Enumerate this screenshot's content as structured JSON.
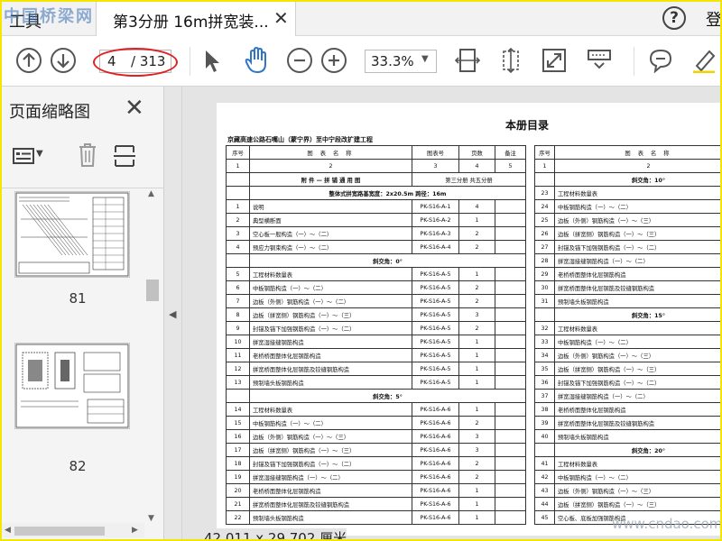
{
  "tabbar": {
    "tools_label": "工具",
    "site_logo": "中国桥梁网",
    "doc_tab_title": "第3分册 16m拼宽装...",
    "close_glyph": "✕",
    "help_glyph": "?",
    "sign_in": "登"
  },
  "toolbar": {
    "prev_page_icon": "arrow-up-circle",
    "next_page_icon": "arrow-down-circle",
    "current_page": "4",
    "total_pages": "/ 313",
    "zoom": "33.3%",
    "highlight_color": "#e02020"
  },
  "sidebar": {
    "title": "页面缩略图",
    "thumbnails": [
      {
        "page": "81"
      },
      {
        "page": "82"
      }
    ]
  },
  "document": {
    "book_title": "本册目录",
    "project_title": "京藏高速公路石嘴山（蒙宁界）至中宁段改扩建工程",
    "left_header": {
      "no": "序号",
      "name": "图 表 名 称",
      "code": "图表号",
      "pages": "页数",
      "note": "备注"
    },
    "left_index": [
      "1",
      "2",
      "3",
      "4",
      "5"
    ],
    "left_rows": [
      {
        "type": "sec",
        "name": "附 件 — 拼 铺 通 用 图",
        "code": "第三分册 共五分册"
      },
      {
        "type": "sec",
        "name": "整体式拼宽路基宽度：2x20.5m 跨径：16m"
      },
      {
        "no": "1",
        "name": "说明",
        "code": "PK-S16-A-1",
        "pages": "4"
      },
      {
        "no": "2",
        "name": "典型横断面",
        "code": "PK-S16-A-2",
        "pages": "1"
      },
      {
        "no": "3",
        "name": "空心板一般构造（一）～（二）",
        "code": "PK-S16-A-3",
        "pages": "2"
      },
      {
        "no": "4",
        "name": "预应力钢束构造（一）～（二）",
        "code": "PK-S16-A-4",
        "pages": "2"
      },
      {
        "type": "sec",
        "name": "斜交角：0°"
      },
      {
        "no": "5",
        "name": "工程材料数量表",
        "code": "PK-S16-A-5",
        "pages": "1"
      },
      {
        "no": "6",
        "name": "中板钢筋构造（一）～（二）",
        "code": "PK-S16-A-5",
        "pages": "2"
      },
      {
        "no": "7",
        "name": "边板（外侧）钢筋构造（一）～（二）",
        "code": "PK-S16-A-5",
        "pages": "2"
      },
      {
        "no": "8",
        "name": "边板（拼宽侧）钢筋构造（一）～（三）",
        "code": "PK-S16-A-5",
        "pages": "3"
      },
      {
        "no": "9",
        "name": "封锚及锚下加强钢筋构造（一）～（二）",
        "code": "PK-S16-A-5",
        "pages": "2"
      },
      {
        "no": "10",
        "name": "拼宽湿接缝钢筋构造",
        "code": "PK-S16-A-5",
        "pages": "1"
      },
      {
        "no": "11",
        "name": "老桥桥面整体化层钢筋构造",
        "code": "PK-S16-A-5",
        "pages": "1"
      },
      {
        "no": "12",
        "name": "拼宽桥面整体化层钢筋及铰缝钢筋构造",
        "code": "PK-S16-A-5",
        "pages": "1"
      },
      {
        "no": "13",
        "name": "预制墙头板钢筋构造",
        "code": "PK-S16-A-5",
        "pages": "1"
      },
      {
        "type": "sec",
        "name": "斜交角：5°"
      },
      {
        "no": "14",
        "name": "工程材料数量表",
        "code": "PK-S16-A-6",
        "pages": "1"
      },
      {
        "no": "15",
        "name": "中板钢筋构造（一）～（二）",
        "code": "PK-S16-A-6",
        "pages": "2"
      },
      {
        "no": "16",
        "name": "边板（外侧）钢筋构造（一）～（三）",
        "code": "PK-S16-A-6",
        "pages": "3"
      },
      {
        "no": "17",
        "name": "边板（拼宽侧）钢筋构造（一）～（三）",
        "code": "PK-S16-A-6",
        "pages": "3"
      },
      {
        "no": "18",
        "name": "封锚及锚下加强钢筋构造（一）～（二）",
        "code": "PK-S16-A-6",
        "pages": "2"
      },
      {
        "no": "19",
        "name": "拼宽湿接缝钢筋构造（一）～（二）",
        "code": "PK-S16-A-6",
        "pages": "2"
      },
      {
        "no": "20",
        "name": "老桥桥面整体化层钢筋构造",
        "code": "PK-S16-A-6",
        "pages": "1"
      },
      {
        "no": "21",
        "name": "拼宽桥面整体化层钢筋及铰缝钢筋构造",
        "code": "PK-S16-A-6",
        "pages": "1"
      },
      {
        "no": "22",
        "name": "预制墙头板钢筋构造",
        "code": "PK-S16-A-6",
        "pages": "1"
      }
    ],
    "right_header": {
      "no": "序号",
      "name": "图 表 名 称"
    },
    "right_index": [
      "1",
      "2"
    ],
    "right_rows": [
      {
        "type": "sec",
        "name": "斜交角：10°"
      },
      {
        "no": "23",
        "name": "工程材料数量表"
      },
      {
        "no": "24",
        "name": "中板钢筋构造（一）～（二）"
      },
      {
        "no": "25",
        "name": "边板（外侧）钢筋构造（一）～（三）"
      },
      {
        "no": "26",
        "name": "边板（拼宽侧）钢筋构造（一）～（三）"
      },
      {
        "no": "27",
        "name": "封锚及锚下加强钢筋构造（一）～（二）"
      },
      {
        "no": "28",
        "name": "拼宽湿接缝钢筋构造（一）～（二）"
      },
      {
        "no": "29",
        "name": "老桥桥面整体化层钢筋构造"
      },
      {
        "no": "30",
        "name": "拼宽桥面整体化层钢筋及铰缝钢筋构造"
      },
      {
        "no": "31",
        "name": "预制墙头板钢筋构造"
      },
      {
        "type": "sec",
        "name": "斜交角：15°"
      },
      {
        "no": "32",
        "name": "工程材料数量表"
      },
      {
        "no": "33",
        "name": "中板钢筋构造（一）～（二）"
      },
      {
        "no": "34",
        "name": "边板（外侧）钢筋构造（一）～（三）"
      },
      {
        "no": "35",
        "name": "边板（拼宽侧）钢筋构造（一）～（三）"
      },
      {
        "no": "36",
        "name": "封锚及锚下加强钢筋构造（一）～（二）"
      },
      {
        "no": "37",
        "name": "拼宽湿接缝钢筋构造（一）～（二）"
      },
      {
        "no": "38",
        "name": "老桥桥面整体化层钢筋构造"
      },
      {
        "no": "39",
        "name": "拼宽桥面整体化层钢筋及铰缝钢筋构造"
      },
      {
        "no": "40",
        "name": "预制墙头板钢筋构造"
      },
      {
        "type": "sec",
        "name": "斜交角：20°"
      },
      {
        "no": "41",
        "name": "工程材料数量表"
      },
      {
        "no": "42",
        "name": "中板钢筋构造（一）～（二）"
      },
      {
        "no": "43",
        "name": "边板（外侧）钢筋构造（一）～（三）"
      },
      {
        "no": "44",
        "name": "边板（拼宽侧）钢筋构造（一）～（三）"
      },
      {
        "no": "45",
        "name": "空心板、底板加强钢筋构造"
      }
    ]
  },
  "statusbar": {
    "page_size": "42.011 x 29.702 厘米",
    "watermark": "www.cndao.com"
  }
}
